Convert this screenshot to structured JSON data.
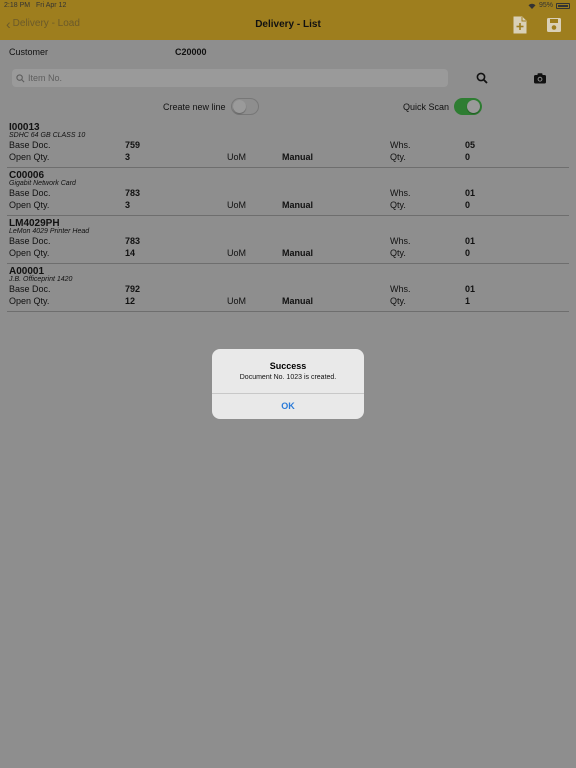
{
  "status_bar": {
    "time": "2:18 PM",
    "date": "Fri Apr 12",
    "battery": "95%"
  },
  "nav": {
    "back_label": "Delivery - Load",
    "title": "Delivery - List"
  },
  "customer": {
    "label": "Customer",
    "value": "C20000"
  },
  "search": {
    "placeholder": "Item No."
  },
  "toggles": {
    "create_new_line": {
      "label": "Create new line",
      "on": false
    },
    "quick_scan": {
      "label": "Quick Scan",
      "on": true
    }
  },
  "labels": {
    "base_doc": "Base Doc.",
    "open_qty": "Open Qty.",
    "uom": "UoM",
    "whs": "Whs.",
    "qty": "Qty."
  },
  "items": [
    {
      "code": "I00013",
      "desc": "SDHC 64 GB CLASS 10",
      "base_doc": "759",
      "open_qty": "3",
      "uom": "Manual",
      "whs": "05",
      "qty": "0"
    },
    {
      "code": "C00006",
      "desc": "Gigabit Network Card",
      "base_doc": "783",
      "open_qty": "3",
      "uom": "Manual",
      "whs": "01",
      "qty": "0"
    },
    {
      "code": "LM4029PH",
      "desc": "LeMon 4029 Printer Head",
      "base_doc": "783",
      "open_qty": "14",
      "uom": "Manual",
      "whs": "01",
      "qty": "0"
    },
    {
      "code": "A00001",
      "desc": "J.B. Officeprint 1420",
      "base_doc": "792",
      "open_qty": "12",
      "uom": "Manual",
      "whs": "01",
      "qty": "1"
    }
  ],
  "alert": {
    "title": "Success",
    "message": "Document No. 1023 is created.",
    "ok_label": "OK"
  },
  "colors": {
    "header": "#9e7e1e",
    "overlay_bg": "#8e8e8e",
    "toggle_on": "#2e7d32",
    "alert_button": "#2a7ad8"
  },
  "icons": {
    "back": "chevron-left-icon",
    "new_document": "new-document-icon",
    "save": "save-icon",
    "search": "search-icon",
    "camera": "camera-icon"
  }
}
